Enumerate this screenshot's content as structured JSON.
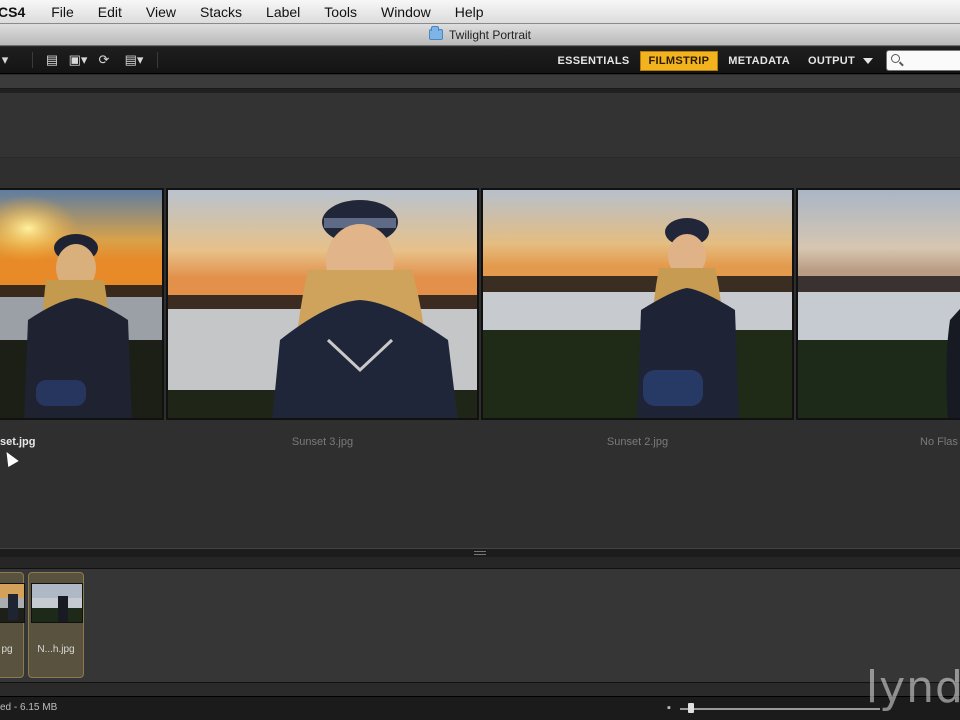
{
  "menubar": {
    "app_name": "CS4",
    "items": [
      "File",
      "Edit",
      "View",
      "Stacks",
      "Label",
      "Tools",
      "Window",
      "Help"
    ]
  },
  "window": {
    "title": "Twilight Portrait"
  },
  "toolbar": {
    "workspaces": [
      {
        "label": "ESSENTIALS",
        "active": false
      },
      {
        "label": "FILMSTRIP",
        "active": true
      },
      {
        "label": "METADATA",
        "active": false
      },
      {
        "label": "OUTPUT",
        "active": false,
        "dropdown": true
      }
    ],
    "search_placeholder": ""
  },
  "preview": {
    "photos": [
      {
        "caption": "set.jpg",
        "selected": true
      },
      {
        "caption": "Sunset 3.jpg",
        "selected": false
      },
      {
        "caption": "Sunset 2.jpg",
        "selected": false
      },
      {
        "caption": "No Flas",
        "selected": false
      }
    ]
  },
  "filmstrip": {
    "thumbs": [
      {
        "label": "pg"
      },
      {
        "label": "N...h.jpg"
      }
    ]
  },
  "statusbar": {
    "count": "ed - 6.15 MB"
  },
  "watermark": "lynd",
  "colors": {
    "accent": "#f2b31f",
    "panel": "#2f2f2f",
    "toolbar": "#1a1a1a"
  }
}
